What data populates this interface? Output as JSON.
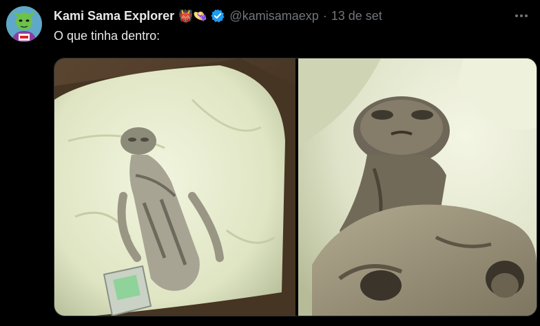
{
  "tweet": {
    "author_name": "Kami Sama Explorer",
    "author_emojis": "👹👒",
    "handle": "@kamisamaexp",
    "separator": "·",
    "date": "13 de set",
    "text": "O que tinha dentro:",
    "more_icon": "more-icon"
  },
  "colors": {
    "background": "#000000",
    "text": "#e7e9ea",
    "muted": "#71767b",
    "verified": "#1d9bf0"
  }
}
